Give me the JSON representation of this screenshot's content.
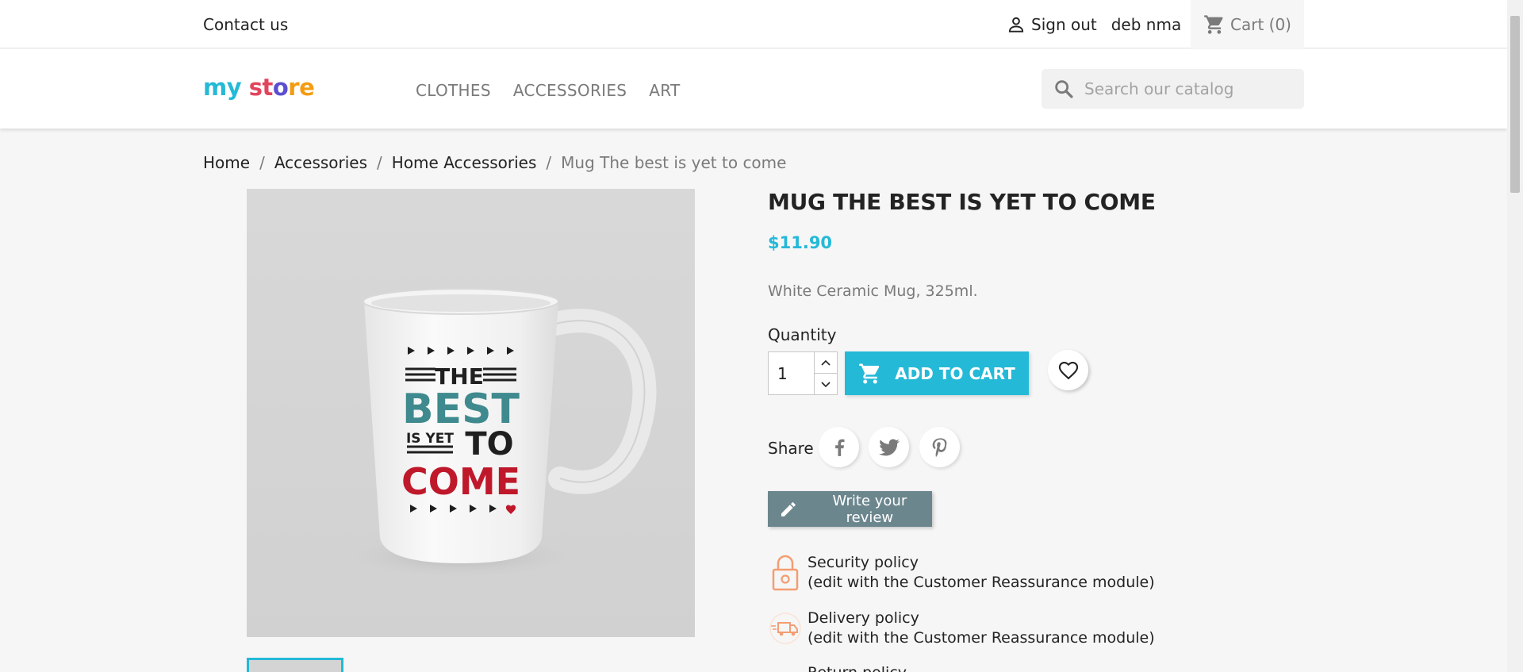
{
  "topbar": {
    "contact": "Contact us",
    "sign_out": "Sign out",
    "username": "deb nma",
    "cart": "Cart (0)"
  },
  "header": {
    "logo": {
      "part1": "my ",
      "part2": "st",
      "part3": "o",
      "part4": "re"
    },
    "nav": [
      "CLOTHES",
      "ACCESSORIES",
      "ART"
    ],
    "search_placeholder": "Search our catalog"
  },
  "breadcrumb": [
    "Home",
    "Accessories",
    "Home Accessories",
    "Mug The best is yet to come"
  ],
  "product": {
    "title": "MUG THE BEST IS YET TO COME",
    "price": "$11.90",
    "description": "White Ceramic Mug, 325ml.",
    "quantity_label": "Quantity",
    "quantity_value": "1",
    "add_to_cart": "ADD TO CART",
    "share_label": "Share",
    "write_review": "Write your review",
    "mug_text": {
      "the": "THE",
      "best": "BEST",
      "is_yet": "IS YET",
      "to": "TO",
      "come": "COME"
    }
  },
  "reassurance": [
    {
      "title": "Security policy",
      "subtitle": "(edit with the Customer Reassurance module)",
      "icon": "lock-icon"
    },
    {
      "title": "Delivery policy",
      "subtitle": "(edit with the Customer Reassurance module)",
      "icon": "delivery-truck-icon"
    },
    {
      "title": "Return policy",
      "subtitle": "",
      "icon": "return-icon"
    }
  ],
  "colors": {
    "accent": "#24b9d7",
    "review_button": "#6c868e",
    "reassurance_icon": "#f39d72",
    "mug_teal": "#3f8a8e",
    "mug_red": "#c0182b"
  }
}
